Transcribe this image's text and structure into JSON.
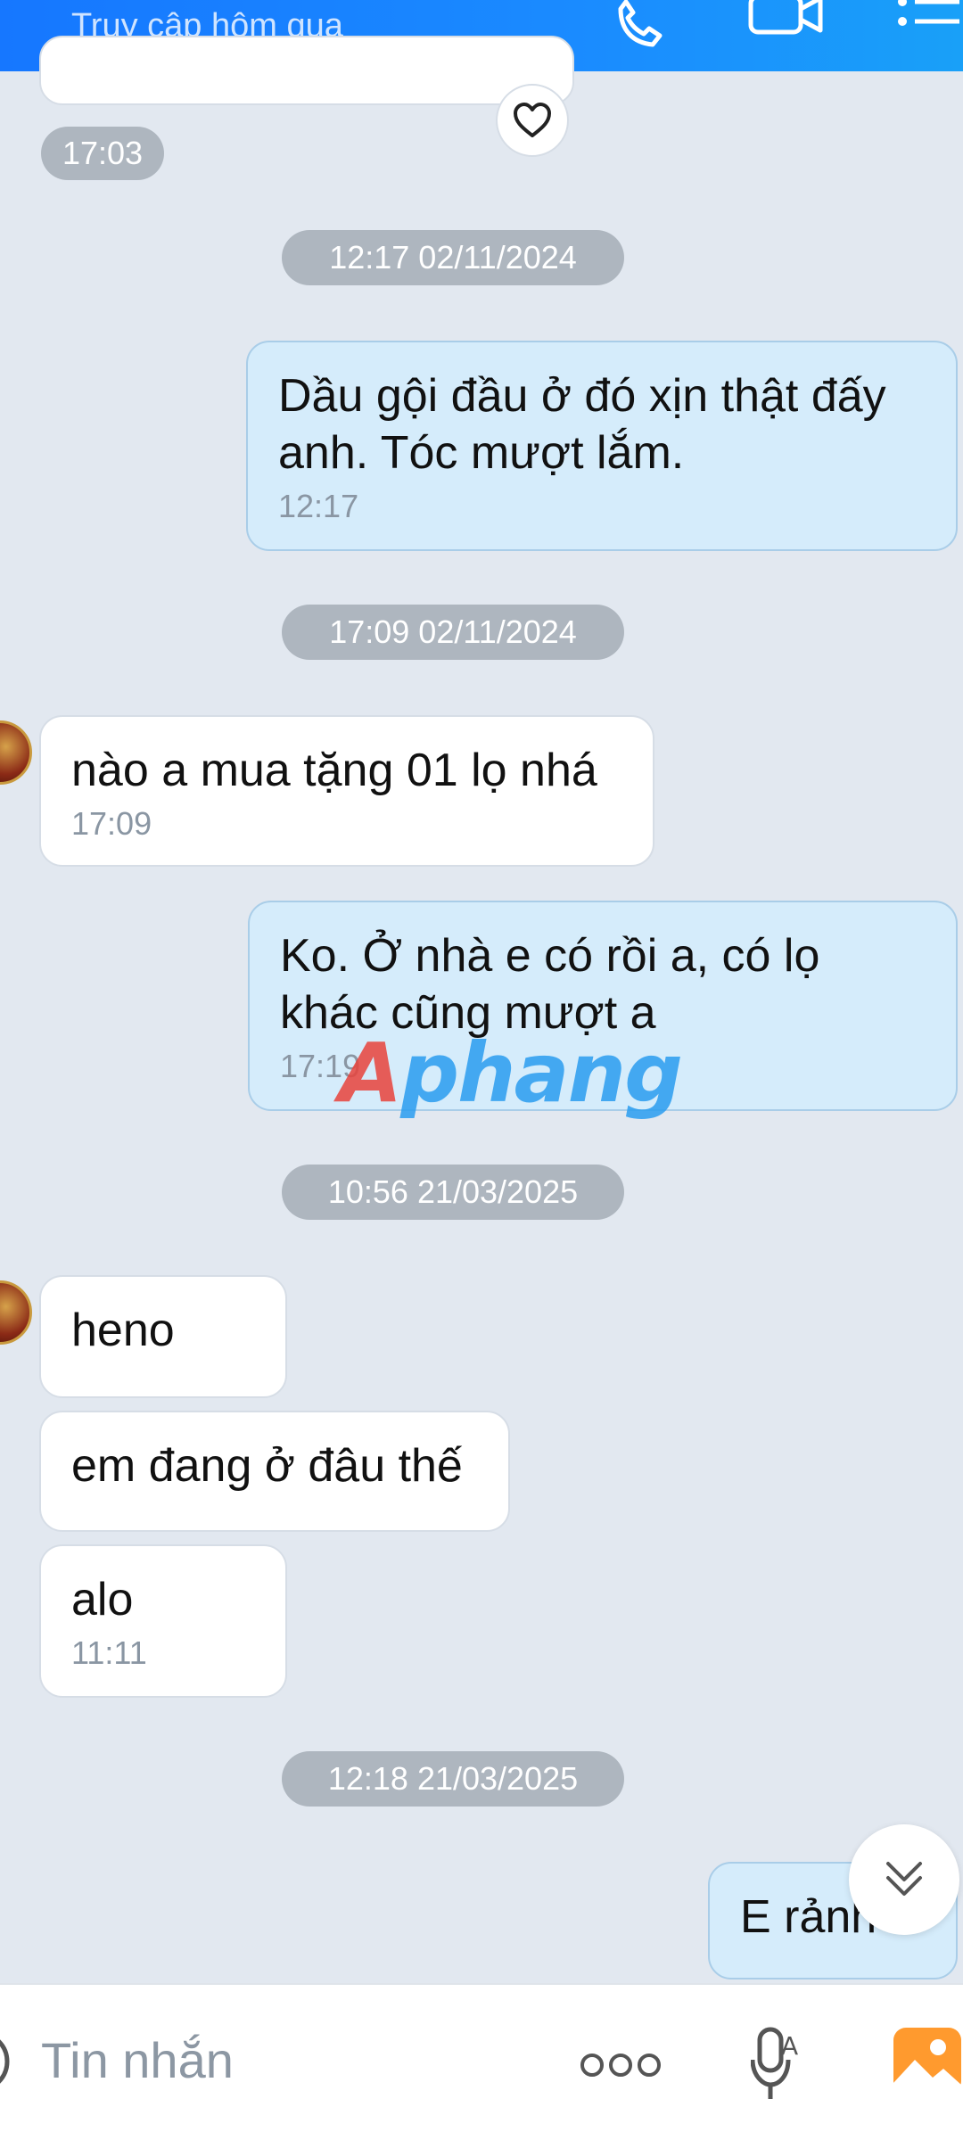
{
  "header": {
    "subtitle": "Truy cập hôm qua",
    "icons": [
      "phone-icon",
      "video-icon",
      "menu-icon"
    ]
  },
  "chat": {
    "prev_time": "17:03",
    "dividers": [
      "12:17 02/11/2024",
      "17:09 02/11/2024",
      "10:56 21/03/2025",
      "12:18 21/03/2025"
    ],
    "messages": [
      {
        "side": "out",
        "text": "Dầu gội đầu ở đó xịn thật đấy anh. Tóc mượt lắm.",
        "time": "12:17"
      },
      {
        "side": "in",
        "text": "nào a mua tặng 01 lọ nhá",
        "time": "17:09"
      },
      {
        "side": "out",
        "text": "Ko. Ở  nhà  e có  rồi  a, có   lọ khác  cũng  mượt  a",
        "time": "17:19"
      },
      {
        "side": "in",
        "text": "heno"
      },
      {
        "side": "in",
        "text": "em đang ở đâu thế"
      },
      {
        "side": "in",
        "text": "alo",
        "time": "11:11"
      },
      {
        "side": "out",
        "text": "E rảnh  a"
      }
    ]
  },
  "watermark": {
    "first": "A",
    "rest": "phang"
  },
  "composer": {
    "placeholder": "Tin nhắn",
    "icons": [
      "sticker-icon",
      "more-icon",
      "voice-icon",
      "image-icon"
    ]
  },
  "colors": {
    "header": "#1677ff",
    "background": "#e2e8f0",
    "outgoing_bubble": "#d5ecfb",
    "incoming_bubble": "#ffffff",
    "pill": "#aeb6bf"
  }
}
